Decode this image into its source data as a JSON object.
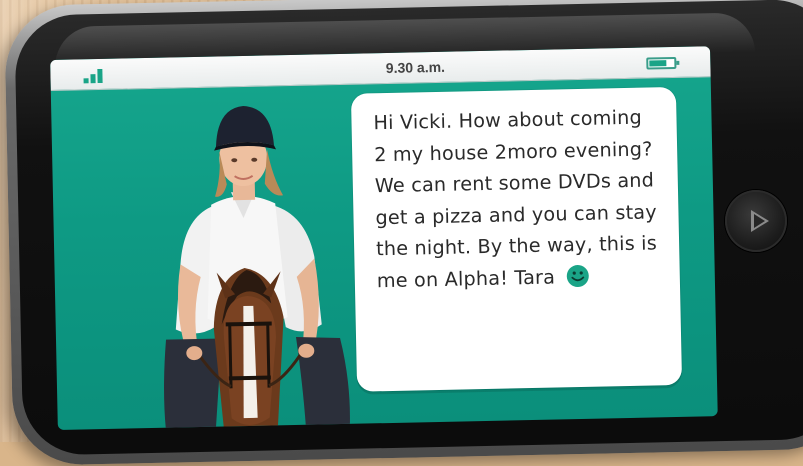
{
  "status_bar": {
    "time": "9.30 a.m.",
    "signal_bars": 3,
    "battery_level": 0.7,
    "accent_color": "#1aa487"
  },
  "screen": {
    "background_color": "#0e9a84"
  },
  "message": {
    "text": "Hi Vicki. How about coming 2 my house 2moro evening? We can rent some DVDs and get a pizza and you can stay the night. By the way, this is me on Alpha! Tara",
    "emoji": "smiley-face-icon"
  },
  "device": {
    "home_button_icon": "play-triangle-icon"
  }
}
